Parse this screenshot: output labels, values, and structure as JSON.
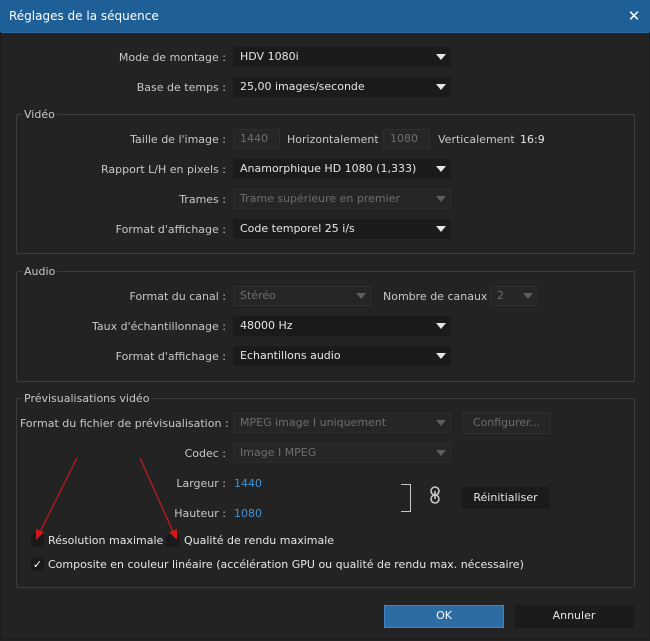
{
  "window": {
    "title": "Réglages de la séquence",
    "close_icon": "close-icon"
  },
  "general": {
    "editing_mode_label": "Mode de montage :",
    "editing_mode_value": "HDV 1080i",
    "timebase_label": "Base de temps :",
    "timebase_value": "25,00 images/seconde"
  },
  "video": {
    "group_label": "Vidéo",
    "frame_size_label": "Taille de l'image :",
    "frame_width": "1440",
    "horizontal_label": "Horizontalement",
    "frame_height": "1080",
    "vertical_label": "Verticalement",
    "aspect": "16:9",
    "pixel_aspect_label": "Rapport L/H en pixels :",
    "pixel_aspect_value": "Anamorphique HD 1080 (1,333)",
    "fields_label": "Trames :",
    "fields_value": "Trame supérieure en premier",
    "display_format_label": "Format d'affichage :",
    "display_format_value": "Code temporel 25 i/s"
  },
  "audio": {
    "group_label": "Audio",
    "channel_format_label": "Format du canal :",
    "channel_format_value": "Stéréo",
    "channel_count_label": "Nombre de canaux :",
    "channel_count_value": "2",
    "sample_rate_label": "Taux d'échantillonnage :",
    "sample_rate_value": "48000 Hz",
    "display_format_label": "Format d'affichage :",
    "display_format_value": "Echantillons audio"
  },
  "previews": {
    "group_label": "Prévisualisations vidéo",
    "file_format_label": "Format du fichier de prévisualisation :",
    "file_format_value": "MPEG image I uniquement",
    "configure_label": "Configurer...",
    "codec_label": "Codec :",
    "codec_value": "Image I MPEG",
    "width_label": "Largeur :",
    "width_value": "1440",
    "height_label": "Hauteur :",
    "height_value": "1080",
    "reset_label": "Réinitialiser",
    "max_resolution_label": "Résolution maximale",
    "max_resolution_checked": false,
    "max_quality_label": "Qualité de rendu maximale",
    "max_quality_checked": false,
    "linear_composite_label": "Composite en couleur linéaire (accélération GPU ou qualité de rendu max. nécessaire)",
    "linear_composite_checked": true,
    "check_glyph": "✓"
  },
  "footer": {
    "ok_label": "OK",
    "cancel_label": "Annuler"
  },
  "colors": {
    "titlebar": "#1f5f98",
    "primary_button": "#2d6ba3",
    "link_value": "#3f93d8",
    "annotation_arrow": "#cc1a1a"
  }
}
